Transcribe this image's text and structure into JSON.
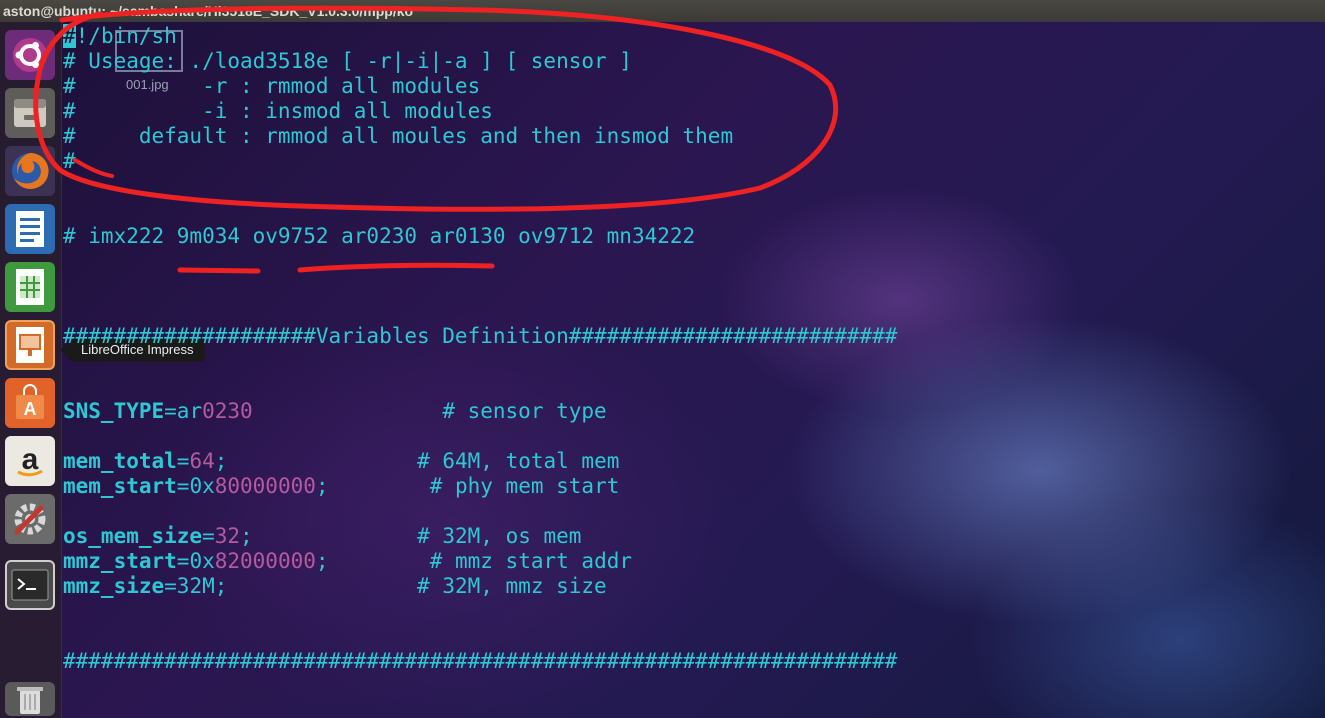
{
  "window": {
    "title": "aston@ubuntu: ~/sambashare/Hi3518E_SDK_V1.0.3.0/mpp/ko"
  },
  "launcher": {
    "items": [
      {
        "name": "ubuntu-dash",
        "icon": "ubuntu-logo-icon"
      },
      {
        "name": "files",
        "icon": "file-manager-icon"
      },
      {
        "name": "firefox",
        "icon": "firefox-icon"
      },
      {
        "name": "libreoffice-writer",
        "icon": "writer-document-icon"
      },
      {
        "name": "libreoffice-calc",
        "icon": "calc-spreadsheet-icon"
      },
      {
        "name": "libreoffice-impress",
        "icon": "impress-presentation-icon"
      },
      {
        "name": "software-center",
        "icon": "shopping-bag-icon"
      },
      {
        "name": "amazon",
        "icon": "amazon-icon"
      },
      {
        "name": "system-settings",
        "icon": "settings-tools-icon"
      },
      {
        "name": "terminal",
        "icon": "terminal-icon"
      },
      {
        "name": "trash",
        "icon": "trash-icon"
      }
    ],
    "tooltip": "LibreOffice Impress",
    "colors": {
      "writer": "#2d6bb3",
      "calc": "#3f9a3f",
      "impress": "#d26a28",
      "software": "#e1632a",
      "terminal": "#2a2a2a"
    }
  },
  "desktop": {
    "thumbnail_label": "001.jpg"
  },
  "terminal": {
    "colors": {
      "text": "#2ec8d4",
      "number": "#b65aa0",
      "annotation": "#ee2222"
    },
    "shebang_hash": "#",
    "shebang_rest": "!/bin/sh",
    "comment1": "# Useage: ./load3518e [ -r|-i|-a ] [ sensor ]",
    "comment2": "#          -r : rmmod all modules",
    "comment3": "#          -i : insmod all modules",
    "comment4": "#     default : rmmod all moules and then insmod them",
    "comment5": "#",
    "sensors": "# imx222 9m034 ov9752 ar0230 ar0130 ov9712 mn34222",
    "section_header": "####################Variables Definition##########################",
    "sns_type": {
      "name": "SNS_TYPE",
      "eq": "=ar",
      "num": "0230",
      "pad": "               ",
      "comment": "# sensor type"
    },
    "mem_total": {
      "name": "mem_total",
      "eq": "=",
      "num": "64",
      "rest": ";",
      "pad": "               ",
      "comment": "# 64M, total mem"
    },
    "mem_start": {
      "name": "mem_start",
      "eq": "=0x",
      "num": "80000000",
      "rest": ";",
      "pad": "        ",
      "comment": "# phy mem start"
    },
    "os_mem_size": {
      "name": "os_mem_size",
      "eq": "=",
      "num": "32",
      "rest": ";",
      "pad": "             ",
      "comment": "# 32M, os mem"
    },
    "mmz_start": {
      "name": "mmz_start",
      "eq": "=0x",
      "num": "82000000",
      "rest": ";",
      "pad": "        ",
      "comment": "# mmz start addr"
    },
    "mmz_size": {
      "name": "mmz_size",
      "eq": "=32M;",
      "pad": "               ",
      "comment": "# 32M, mmz size"
    },
    "section_footer": "##################################################################"
  }
}
